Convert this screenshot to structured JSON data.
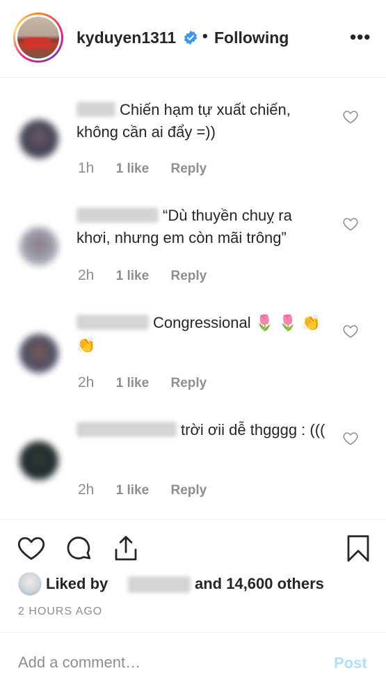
{
  "header": {
    "username": "kyduyen1311",
    "verified_icon": "verified-badge-icon",
    "separator": "•",
    "follow_status": "Following",
    "more_label": "•••"
  },
  "comments": [
    {
      "text": "Chiến hạm tự xuất chiến, không cần ai đẩy =))",
      "time": "1h",
      "likes": "1 like",
      "reply": "Reply"
    },
    {
      "text": "“Dù thuyền chuỵ ra khơi, nhưng em còn mãi trông”",
      "time": "2h",
      "likes": "1 like",
      "reply": "Reply"
    },
    {
      "text": "Congressional 🌷 🌷 👏 👏",
      "time": "2h",
      "likes": "1 like",
      "reply": "Reply"
    },
    {
      "text": "trời ơii dễ thgggg : (((",
      "time": "2h",
      "likes": "1 like",
      "reply": "Reply"
    }
  ],
  "likes": {
    "liked_by": "Liked by",
    "and_others": "and 14,600 others"
  },
  "timestamp": "2 HOURS AGO",
  "comment_bar": {
    "placeholder": "Add a comment…",
    "post_label": "Post"
  },
  "colors": {
    "accent": "#0095f6",
    "post_disabled": "#b2dffc",
    "muted": "#8e8e8e",
    "verified": "#3897f0"
  }
}
